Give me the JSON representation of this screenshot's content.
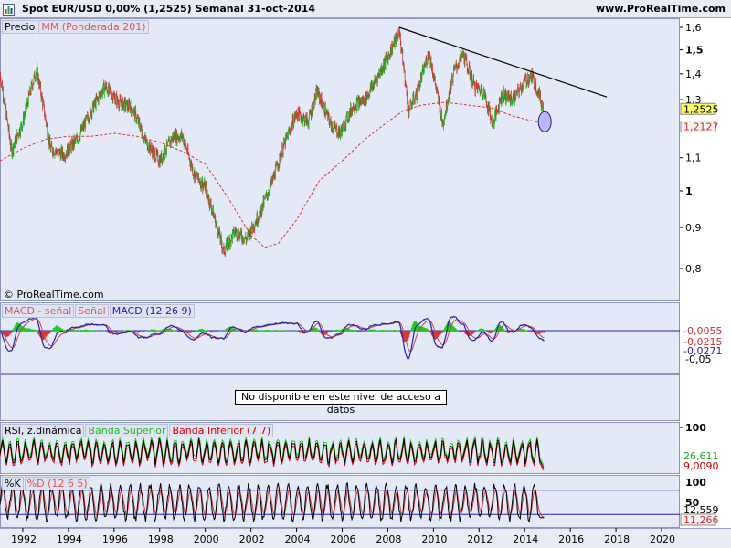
{
  "header": {
    "title": "Spot EUR/USD   0,00% (1,2525)   Semanal   31-oct-2014",
    "url": "www.ProRealTime.com"
  },
  "colors": {
    "up_candle": "#22aa22",
    "down_candle": "#cc3333",
    "moving_average": "#dd3333",
    "trendline": "#000000",
    "macd_line": "#2222aa",
    "macd_signal": "#cc4444",
    "histogram_positive": "#22cc22",
    "histogram_negative": "#dd3333",
    "rsi_line": "#000000",
    "rsi_upper_band": "#22cc22",
    "rsi_lower_band": "#dd0000",
    "stoch_k": "#000000",
    "stoch_d": "#cc4444",
    "panel_bg": "#e4e9f7"
  },
  "price_panel": {
    "legend": [
      "Precio",
      "MM (Ponderada 201)"
    ],
    "y_ticks": [
      "1,6",
      "1,5",
      "1,4",
      "1,3",
      "1,1",
      "1",
      "0,9",
      "0,8"
    ],
    "last_price": "1,2525",
    "ma_value": "1,2127",
    "copyright": "© ProRealTime.com"
  },
  "macd_panel": {
    "legend": [
      "MACD - señal",
      "Señal",
      "MACD (12 26 9)"
    ],
    "values": [
      "-0,0055",
      "-0,0215",
      "-0,0271"
    ],
    "y_tick_partial": "-0,05"
  },
  "na_panel": {
    "message": "No disponible en este nivel de acceso a datos"
  },
  "rsi_panel": {
    "legend": [
      "RSI, z.dinámica",
      "Banda Superior",
      "Banda Inferior (7 7)"
    ],
    "y_tick": "100",
    "values": [
      "26,611",
      "9,0090"
    ]
  },
  "stoch_panel": {
    "legend": [
      "%K",
      "%D (12 6 5)"
    ],
    "y_ticks": [
      "100",
      "50"
    ],
    "values": [
      "12,559",
      "11,266"
    ]
  },
  "x_axis": {
    "labels": [
      "1992",
      "1994",
      "1996",
      "1998",
      "2000",
      "2002",
      "2004",
      "2006",
      "2008",
      "2010",
      "2012",
      "2014",
      "2016",
      "2018",
      "2020"
    ]
  },
  "chart_data": {
    "type": "candlestick",
    "title": "Spot EUR/USD",
    "timeframe": "Semanal",
    "date": "31-oct-2014",
    "x_range": [
      1991.0,
      2020.8
    ],
    "y_range": [
      0.78,
      1.62
    ],
    "y_scale": "log",
    "grid": false,
    "last_close": 1.2525,
    "moving_average_last": 1.2127,
    "price_path": [
      [
        1991.0,
        1.4
      ],
      [
        1991.5,
        1.12
      ],
      [
        1992.0,
        1.22
      ],
      [
        1992.6,
        1.42
      ],
      [
        1993.2,
        1.13
      ],
      [
        1993.8,
        1.11
      ],
      [
        1994.4,
        1.16
      ],
      [
        1995.0,
        1.26
      ],
      [
        1995.6,
        1.35
      ],
      [
        1996.2,
        1.29
      ],
      [
        1996.8,
        1.27
      ],
      [
        1997.4,
        1.15
      ],
      [
        1998.0,
        1.09
      ],
      [
        1998.6,
        1.17
      ],
      [
        1999.0,
        1.17
      ],
      [
        1999.5,
        1.05
      ],
      [
        2000.0,
        1.01
      ],
      [
        2000.8,
        0.84
      ],
      [
        2001.3,
        0.89
      ],
      [
        2001.8,
        0.87
      ],
      [
        2002.4,
        0.94
      ],
      [
        2002.9,
        1.02
      ],
      [
        2003.5,
        1.15
      ],
      [
        2004.0,
        1.25
      ],
      [
        2004.5,
        1.22
      ],
      [
        2004.9,
        1.33
      ],
      [
        2005.5,
        1.21
      ],
      [
        2005.9,
        1.18
      ],
      [
        2006.5,
        1.28
      ],
      [
        2007.0,
        1.3
      ],
      [
        2007.5,
        1.38
      ],
      [
        2008.0,
        1.47
      ],
      [
        2008.5,
        1.58
      ],
      [
        2008.9,
        1.26
      ],
      [
        2009.3,
        1.33
      ],
      [
        2009.8,
        1.49
      ],
      [
        2010.4,
        1.21
      ],
      [
        2010.9,
        1.41
      ],
      [
        2011.3,
        1.48
      ],
      [
        2011.8,
        1.35
      ],
      [
        2012.2,
        1.33
      ],
      [
        2012.6,
        1.21
      ],
      [
        2013.0,
        1.32
      ],
      [
        2013.5,
        1.3
      ],
      [
        2014.0,
        1.37
      ],
      [
        2014.3,
        1.39
      ],
      [
        2014.6,
        1.33
      ],
      [
        2014.84,
        1.2525
      ]
    ],
    "moving_average_path": [
      [
        1991.0,
        1.09
      ],
      [
        1992.0,
        1.13
      ],
      [
        1993.0,
        1.16
      ],
      [
        1994.0,
        1.17
      ],
      [
        1995.0,
        1.17
      ],
      [
        1996.0,
        1.18
      ],
      [
        1997.0,
        1.17
      ],
      [
        1998.0,
        1.15
      ],
      [
        1999.0,
        1.12
      ],
      [
        2000.0,
        1.08
      ],
      [
        2001.0,
        0.98
      ],
      [
        2002.0,
        0.88
      ],
      [
        2002.6,
        0.85
      ],
      [
        2003.2,
        0.86
      ],
      [
        2004.0,
        0.92
      ],
      [
        2005.0,
        1.03
      ],
      [
        2006.0,
        1.09
      ],
      [
        2007.0,
        1.16
      ],
      [
        2008.0,
        1.22
      ],
      [
        2008.7,
        1.26
      ],
      [
        2009.5,
        1.28
      ],
      [
        2010.5,
        1.29
      ],
      [
        2011.5,
        1.28
      ],
      [
        2012.5,
        1.27
      ],
      [
        2013.5,
        1.24
      ],
      [
        2014.84,
        1.2127
      ]
    ],
    "trendline": [
      [
        2008.5,
        1.6
      ],
      [
        2017.6,
        1.31
      ]
    ],
    "macd": {
      "macd": -0.0271,
      "signal": -0.0215,
      "histogram": -0.0055
    },
    "rsi": {
      "upper_band": 26.611,
      "lower_band": 9.009
    },
    "stochastic": {
      "k": 12.559,
      "d": 11.266,
      "parameters": "12 6 5"
    }
  }
}
